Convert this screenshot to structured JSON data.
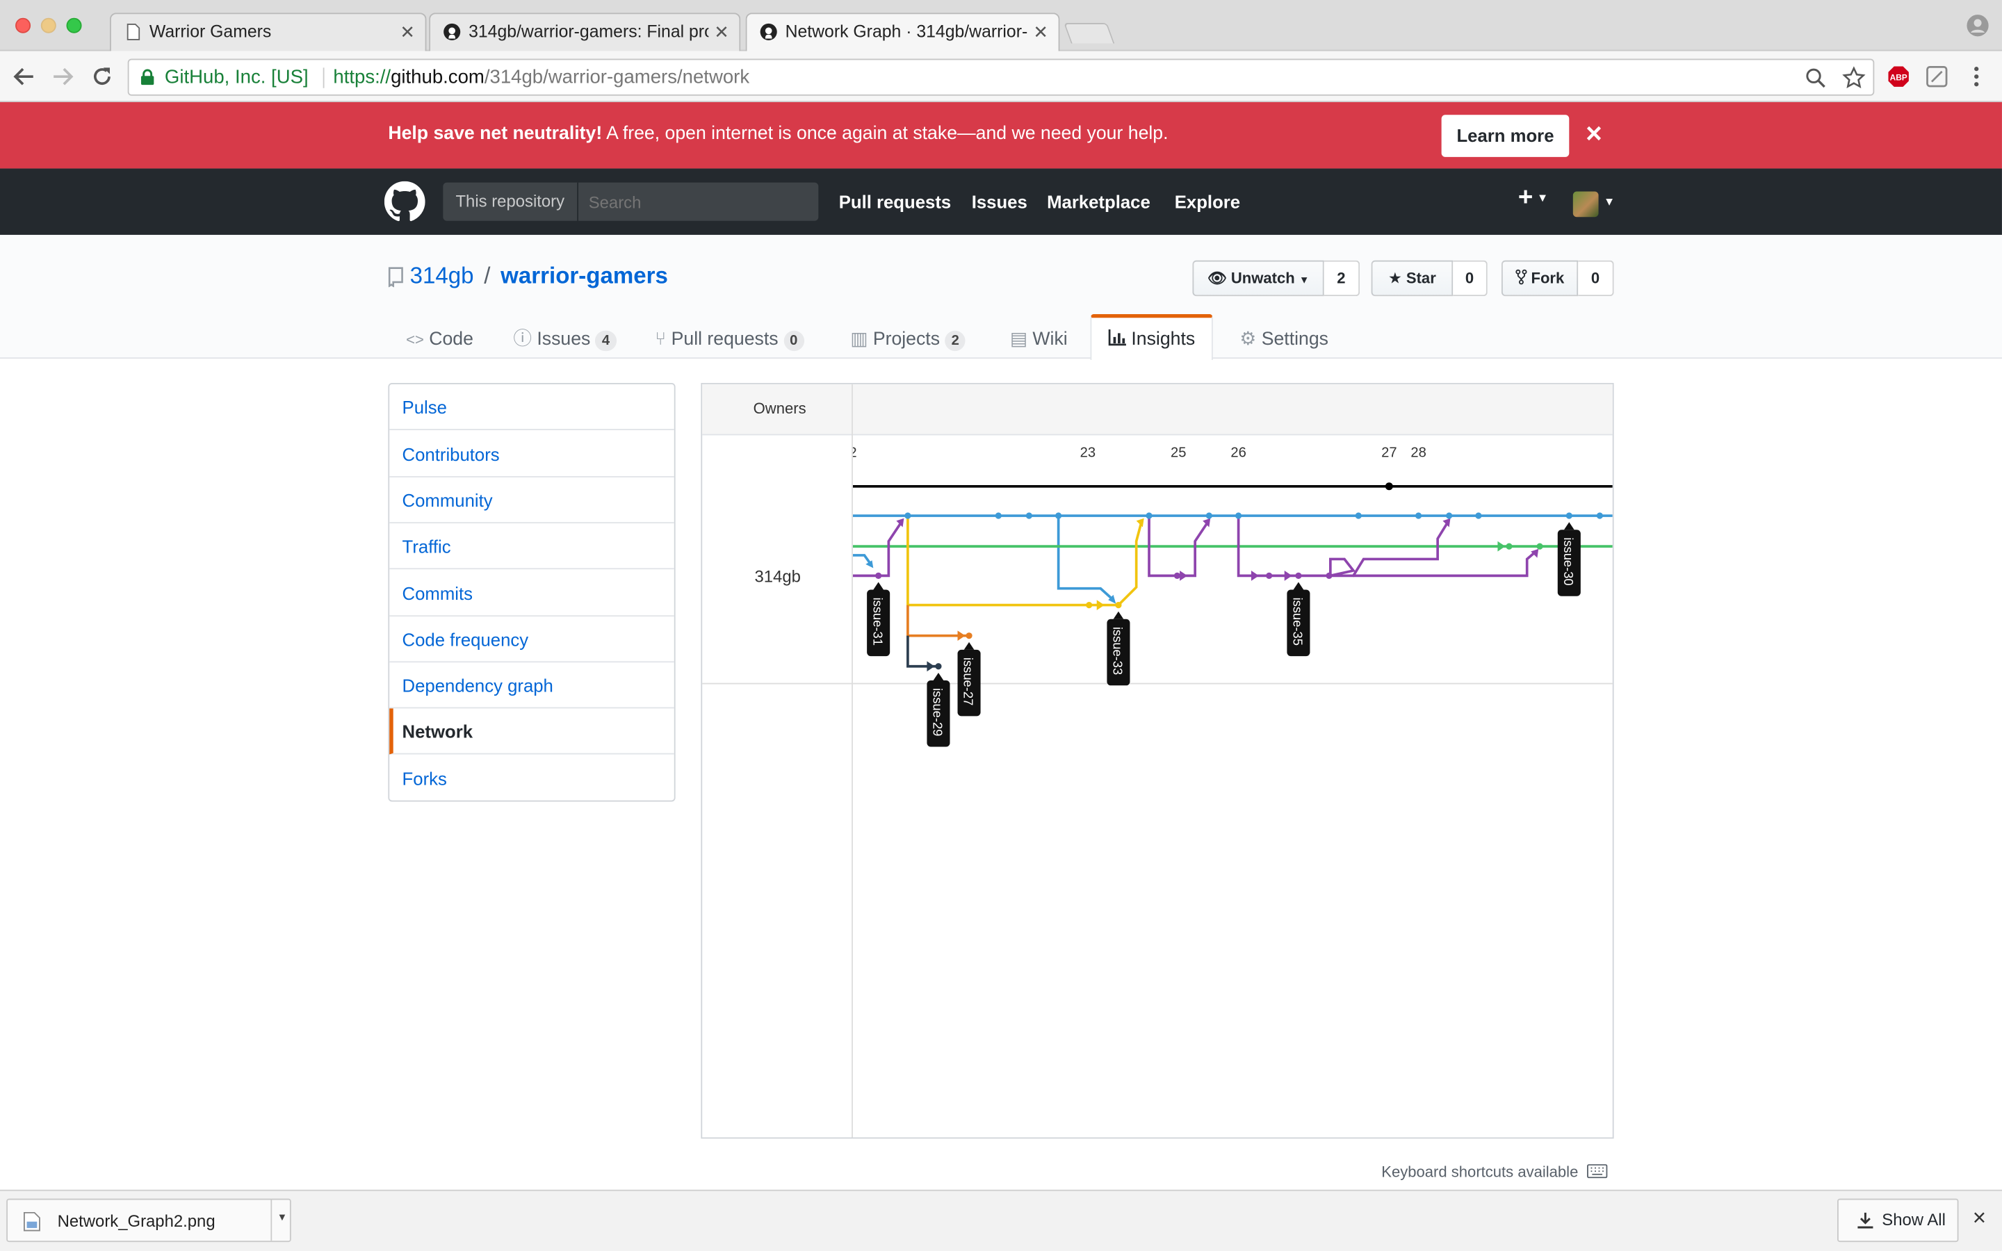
{
  "browser": {
    "tabs": [
      {
        "title": "Warrior Gamers"
      },
      {
        "title": "314gb/warrior-gamers: Final project"
      },
      {
        "title": "Network Graph · 314gb/warrior-gamers"
      }
    ],
    "address": {
      "secure_label": "GitHub, Inc. [US]",
      "scheme": "https://",
      "host": "github.com",
      "path": "/314gb/warrior-gamers/network"
    }
  },
  "banner": {
    "bold": "Help save net neutrality!",
    "text": " A free, open internet is once again at stake—and we need your help.",
    "button": "Learn more",
    "close": "×"
  },
  "header": {
    "scope": "This repository",
    "search_placeholder": "Search",
    "nav": [
      "Pull requests",
      "Issues",
      "Marketplace",
      "Explore"
    ],
    "plus": "+"
  },
  "repo": {
    "owner": "314gb",
    "sep": "/",
    "name": "warrior-gamers",
    "watch": {
      "label": "Unwatch",
      "count": "2"
    },
    "star": {
      "label": "Star",
      "count": "0"
    },
    "fork": {
      "label": "Fork",
      "count": "0"
    },
    "tabs": [
      {
        "label": "Code"
      },
      {
        "label": "Issues",
        "count": "4"
      },
      {
        "label": "Pull requests",
        "count": "0"
      },
      {
        "label": "Projects",
        "count": "2"
      },
      {
        "label": "Wiki"
      },
      {
        "label": "Insights"
      },
      {
        "label": "Settings"
      }
    ]
  },
  "insights_menu": [
    "Pulse",
    "Contributors",
    "Community",
    "Traffic",
    "Commits",
    "Code frequency",
    "Dependency graph",
    "Network",
    "Forks"
  ],
  "network": {
    "owners_header": "Owners",
    "owner": "314gb",
    "dates": [
      "2",
      "23",
      "25",
      "26",
      "27",
      "28"
    ],
    "branch_labels": [
      "issue-31",
      "issue-29",
      "issue-27",
      "issue-33",
      "issue-35",
      "issue-30"
    ],
    "colors": {
      "master": "#000000",
      "blue": "#3d9ad7",
      "green": "#47c369",
      "purple": "#8e44ad",
      "yellow": "#f1c40f",
      "orange": "#e67e22",
      "navy": "#2c3e50"
    }
  },
  "footer": {
    "shortcuts": "Keyboard shortcuts available"
  },
  "downloads": {
    "file": "Network_Graph2.png",
    "show_all": "Show All",
    "close": "×"
  }
}
